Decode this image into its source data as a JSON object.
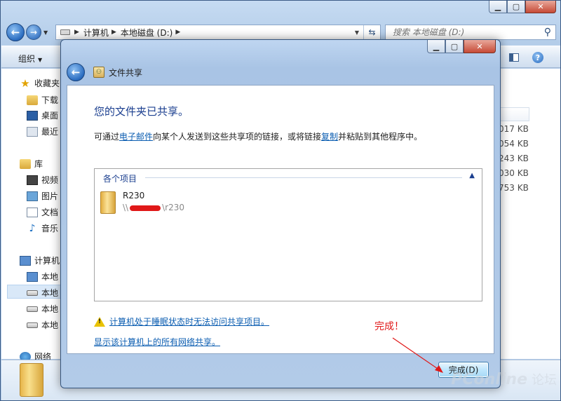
{
  "explorer": {
    "breadcrumbs": [
      "计算机",
      "本地磁盘 (D:)"
    ],
    "search_placeholder": "搜索 本地磁盘 (D:)",
    "toolbar": {
      "organize_label": "组织"
    },
    "sidebar": {
      "favorites_label": "收藏夹",
      "favorites": [
        "下载",
        "桌面",
        "最近"
      ],
      "libraries_label": "库",
      "libraries": [
        "视频",
        "图片",
        "文档",
        "音乐"
      ],
      "computer_label": "计算机",
      "drives": [
        "本地",
        "本地",
        "本地",
        "本地"
      ],
      "network_label": "网络"
    },
    "file_sizes": [
      "017 KB",
      "054 KB",
      "243 KB",
      "030 KB",
      "753 KB"
    ]
  },
  "dialog": {
    "title": "文件共享",
    "headline": "您的文件夹已共享。",
    "desc": {
      "prefix": "可通过",
      "email_link": "电子邮件",
      "middle": "向某个人发送到这些共享项的链接，或将链接",
      "copy_link": "复制",
      "suffix": "并粘贴到其他程序中。"
    },
    "items_header": "各个项目",
    "share_item": {
      "name": "R230",
      "path_prefix": "\\\\",
      "path_suffix": "\\r230"
    },
    "warning_link": "计算机处于睡眠状态时无法访问共享项目。",
    "show_all_link": "显示该计算机上的所有网络共享。",
    "finish_button": "完成(D)"
  },
  "annotation": {
    "text": "完成！",
    "color": "#e01818"
  },
  "watermark": {
    "logo": "PConline",
    "text": "论坛"
  }
}
